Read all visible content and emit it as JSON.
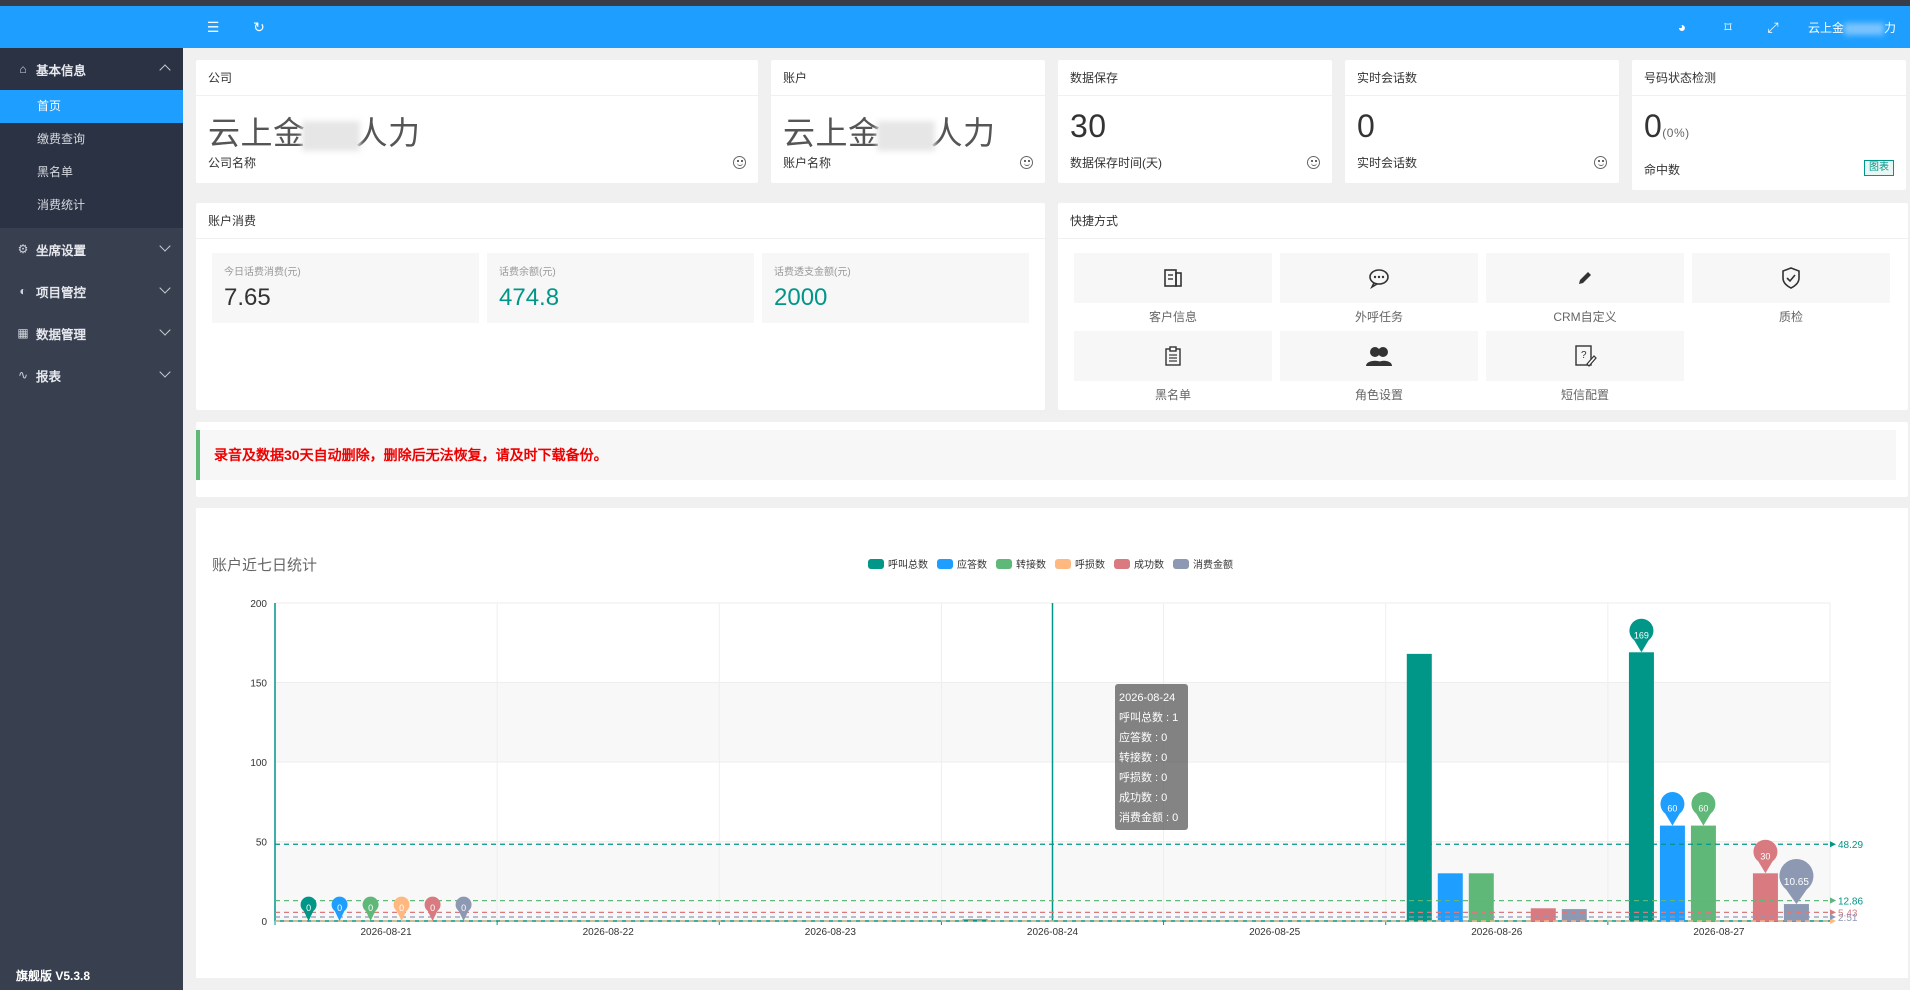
{
  "sidebar": {
    "groups": [
      {
        "label": "基本信息",
        "icon": "home-icon",
        "open": true,
        "items": [
          "首页",
          "缴费查询",
          "黑名单",
          "消费统计"
        ]
      },
      {
        "label": "坐席设置",
        "icon": "gear-icon"
      },
      {
        "label": "项目管控",
        "icon": "project-icon"
      },
      {
        "label": "数据管理",
        "icon": "data-icon"
      },
      {
        "label": "报表",
        "icon": "report-icon"
      }
    ],
    "version": "旗舰版 V5.3.8"
  },
  "header": {
    "user": "云上金",
    "user_suffix": "力"
  },
  "cards": {
    "company": {
      "title": "公司",
      "value_a": "云上金",
      "value_b": "人力",
      "sub": "公司名称"
    },
    "account": {
      "title": "账户",
      "value_a": "云上金",
      "value_b": "人力",
      "sub": "账户名称"
    },
    "retention": {
      "title": "数据保存",
      "value": "30",
      "sub": "数据保存时间(天)"
    },
    "sessions": {
      "title": "实时会话数",
      "value": "0",
      "sub": "实时会话数"
    },
    "number_check": {
      "title": "号码状态检测",
      "value": "0",
      "pct": "(0%)",
      "sub": "命中数",
      "badge": "图表"
    }
  },
  "spend": {
    "title": "账户消费",
    "boxes": [
      {
        "label": "今日话费消费(元)",
        "value": "7.65",
        "color": "#333333"
      },
      {
        "label": "话费余额(元)",
        "value": "474.8",
        "color": "#009688"
      },
      {
        "label": "话费透支金额(元)",
        "value": "2000",
        "color": "#009688"
      }
    ]
  },
  "quick": {
    "title": "快捷方式",
    "items": [
      {
        "label": "客户信息",
        "icon": "customer-info-icon"
      },
      {
        "label": "外呼任务",
        "icon": "outbound-task-icon"
      },
      {
        "label": "CRM自定义",
        "icon": "pencil-icon"
      },
      {
        "label": "质检",
        "icon": "shield-check-icon"
      },
      {
        "label": "黑名单",
        "icon": "clipboard-icon"
      },
      {
        "label": "角色设置",
        "icon": "users-icon"
      },
      {
        "label": "短信配置",
        "icon": "sms-config-icon"
      }
    ]
  },
  "notice": "录音及数据30天自动删除，删除后无法恢复，请及时下载备份。",
  "tooltip": {
    "date": "2026-08-24",
    "lines": [
      "呼叫总数 : 1",
      "应答数 : 0",
      "转接数 : 0",
      "呼损数 : 0",
      "成功数 : 0",
      "消费金额 : 0"
    ]
  },
  "chart_data": {
    "type": "bar",
    "title": "账户近七日统计",
    "categories": [
      "2026-08-21",
      "2026-08-22",
      "2026-08-23",
      "2026-08-24",
      "2026-08-25",
      "2026-08-26",
      "2026-08-27"
    ],
    "ylim": [
      0,
      200
    ],
    "yticks": [
      0,
      50,
      100,
      150,
      200
    ],
    "series": [
      {
        "name": "呼叫总数",
        "color": "#009688",
        "values": [
          0,
          0,
          0,
          1,
          0,
          168,
          169
        ],
        "avg": 48.29
      },
      {
        "name": "应答数",
        "color": "#1e9fff",
        "values": [
          0,
          0,
          0,
          0,
          0,
          30,
          60
        ],
        "avg": 12.86
      },
      {
        "name": "转接数",
        "color": "#5fb878",
        "values": [
          0,
          0,
          0,
          0,
          0,
          30,
          60
        ],
        "avg": 12.86
      },
      {
        "name": "呼损数",
        "color": "#ffb980",
        "values": [
          0,
          0,
          0,
          0,
          0,
          0,
          0
        ],
        "avg": 0
      },
      {
        "name": "成功数",
        "color": "#d87a80",
        "values": [
          0,
          0,
          0,
          0,
          0,
          8,
          30
        ],
        "avg": 5.43
      },
      {
        "name": "消费金额",
        "color": "#8d98b3",
        "values": [
          0,
          0,
          0,
          0,
          0,
          7.5,
          10.65
        ],
        "avg": 2.51
      }
    ],
    "max_labels": [
      {
        "series": 0,
        "index": 6,
        "text": "169"
      },
      {
        "series": 1,
        "index": 6,
        "text": "60"
      },
      {
        "series": 2,
        "index": 6,
        "text": "60"
      },
      {
        "series": 4,
        "index": 6,
        "text": "30"
      },
      {
        "series": 5,
        "index": 6,
        "text": "10.65"
      }
    ],
    "min_labels": [
      "0",
      "0",
      "0",
      "0",
      "0",
      "0"
    ],
    "avg_labels": [
      "48.29",
      "12.86",
      "5.43",
      "2.51"
    ]
  }
}
